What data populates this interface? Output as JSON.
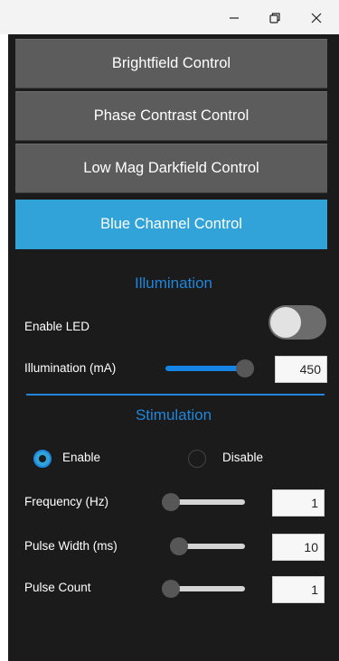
{
  "window_controls": {
    "minimize": "minimize-icon",
    "restore": "restore-icon",
    "close": "close-icon"
  },
  "nav": [
    {
      "label": "Brightfield Control",
      "active": false
    },
    {
      "label": "Phase Contrast Control",
      "active": false
    },
    {
      "label": "Low Mag Darkfield Control",
      "active": false
    },
    {
      "label": "Blue Channel Control",
      "active": true
    }
  ],
  "illumination": {
    "title": "Illumination",
    "enable_led_label": "Enable LED",
    "enable_led_on": false,
    "current_label": "Illumination (mA)",
    "current_value": "450",
    "current_slider_fraction": 1.0
  },
  "stimulation": {
    "title": "Stimulation",
    "enable_label": "Enable",
    "disable_label": "Disable",
    "selected": "Enable",
    "frequency_label": "Frequency (Hz)",
    "frequency_value": "1",
    "frequency_slider_fraction": 0.0,
    "pulse_width_label": "Pulse Width (ms)",
    "pulse_width_value": "10",
    "pulse_width_slider_fraction": 0.11,
    "pulse_count_label": "Pulse Count",
    "pulse_count_value": "1",
    "pulse_count_slider_fraction": 0.0
  },
  "colors": {
    "accent": "#1f86db",
    "active_tab": "#31a3d8",
    "panel_bg": "#1b1b1b",
    "button_bg": "#5c5c5c"
  }
}
